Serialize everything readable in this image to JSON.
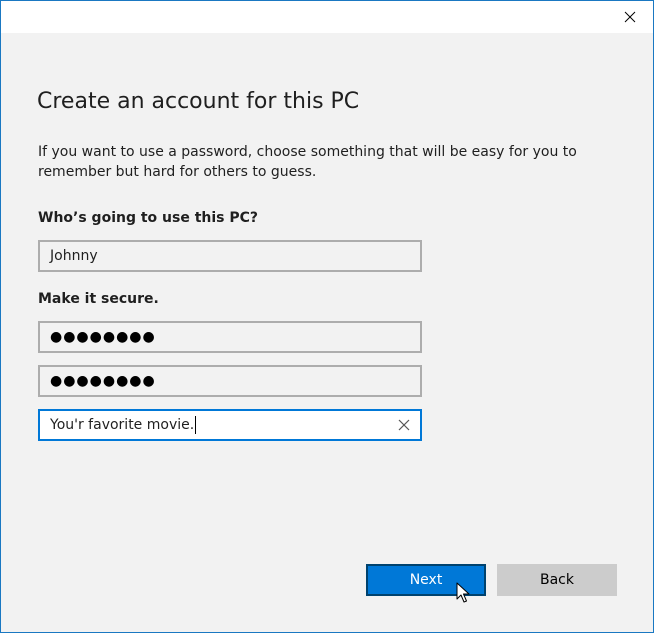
{
  "window": {
    "close_icon": "close-icon"
  },
  "page": {
    "title": "Create an account for this PC",
    "description": "If you want to use a password, choose something that will be easy for you to remember but hard for others to guess."
  },
  "user": {
    "label": "Who’s going to use this PC?",
    "username_value": "Johnny"
  },
  "security": {
    "label": "Make it secure.",
    "password_value": "●●●●●●●●",
    "confirm_password_value": "●●●●●●●●",
    "hint_value": "You'r favorite movie."
  },
  "buttons": {
    "next_label": "Next",
    "back_label": "Back"
  },
  "colors": {
    "accent": "#0078d7",
    "background": "#f2f2f2",
    "secondary_button": "#cccccc"
  }
}
